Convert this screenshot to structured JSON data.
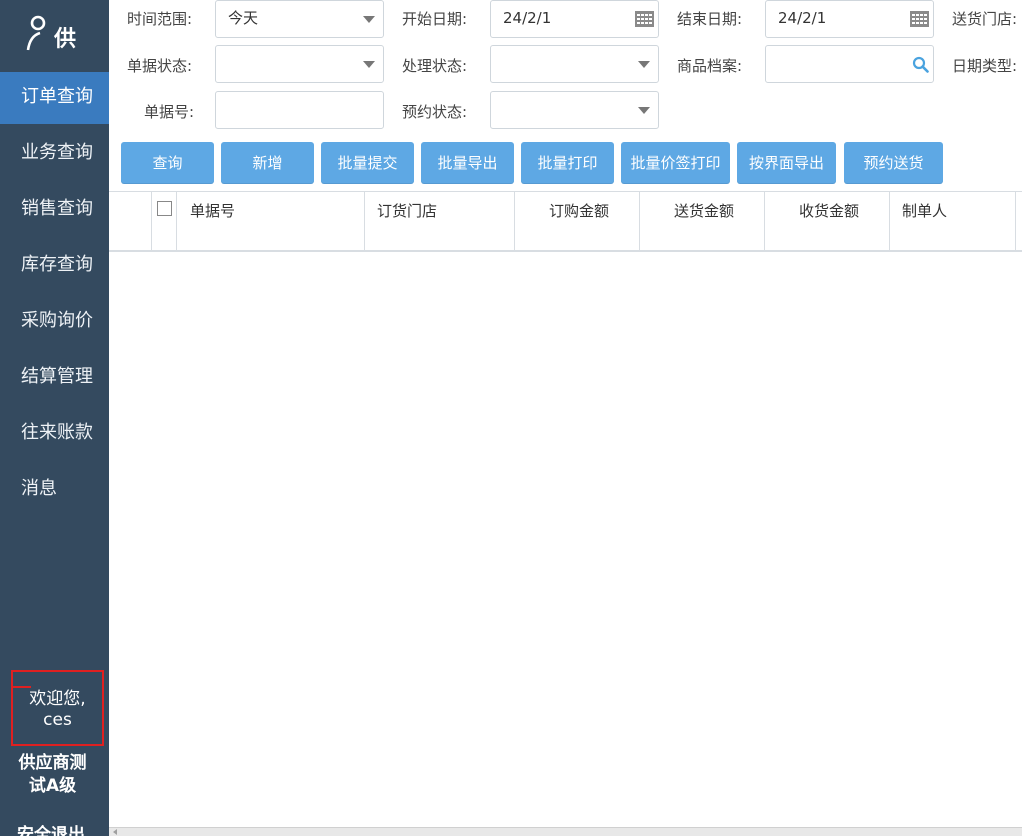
{
  "logo": {
    "text": "供"
  },
  "nav": {
    "items": [
      {
        "label": "订单查询"
      },
      {
        "label": "业务查询"
      },
      {
        "label": "销售查询"
      },
      {
        "label": "库存查询"
      },
      {
        "label": "采购询价"
      },
      {
        "label": "结算管理"
      },
      {
        "label": "往来账款"
      },
      {
        "label": "消息"
      }
    ],
    "welcome_line1": "欢迎您,",
    "welcome_line2": "ces",
    "supplier_line1": "供应商测",
    "supplier_line2": "试A级",
    "logout": "安全退出"
  },
  "filters": {
    "time_range": {
      "label": "时间范围:",
      "value": "今天"
    },
    "start_date": {
      "label": "开始日期:",
      "value": "24/2/1"
    },
    "end_date": {
      "label": "结束日期:",
      "value": "24/2/1"
    },
    "delivery_store": {
      "label": "送货门店:"
    },
    "doc_status": {
      "label": "单据状态:",
      "value": ""
    },
    "process_status": {
      "label": "处理状态:",
      "value": ""
    },
    "product_file": {
      "label": "商品档案:",
      "value": ""
    },
    "date_type": {
      "label": "日期类型:"
    },
    "doc_no": {
      "label": "单据号:",
      "value": ""
    },
    "reservation_status": {
      "label": "预约状态:",
      "value": ""
    }
  },
  "buttons": {
    "query": "查询",
    "add": "新增",
    "batch_submit": "批量提交",
    "batch_export": "批量导出",
    "batch_print": "批量打印",
    "batch_price_tag_print": "批量价签打印",
    "export_by_view": "按界面导出",
    "reserve_delivery": "预约送货"
  },
  "table": {
    "columns": [
      "单据号",
      "订货门店",
      "订购金额",
      "送货金额",
      "收货金额",
      "制单人"
    ],
    "rows": []
  },
  "colors": {
    "sidebar": "#344a5f",
    "active_nav": "#3a7bbf",
    "button": "#5ea8e4",
    "highlight_border": "#e02020"
  }
}
